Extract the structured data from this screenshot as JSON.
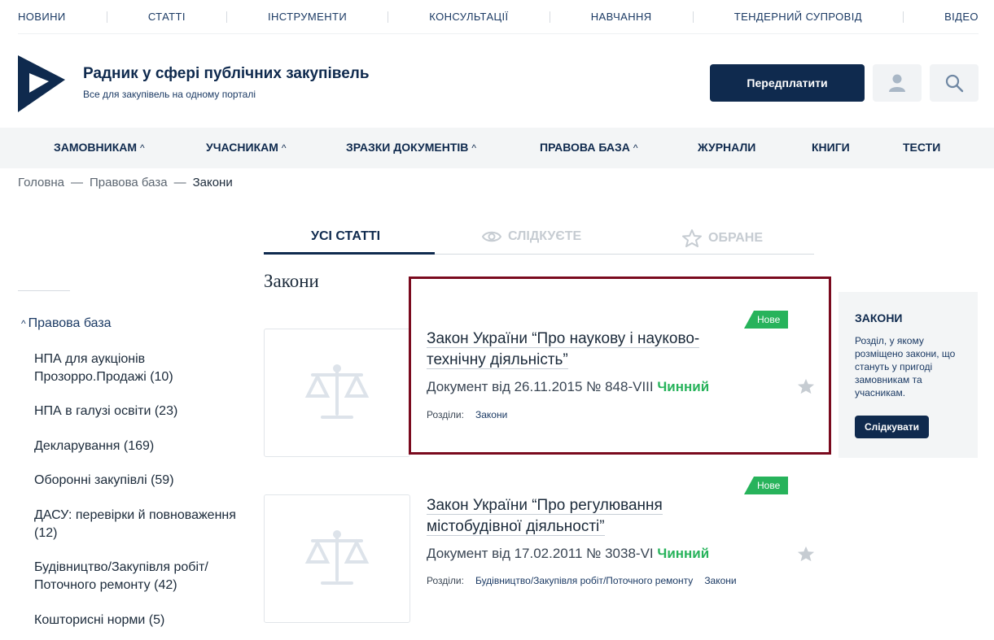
{
  "topnav": [
    "НОВИНИ",
    "СТАТТІ",
    "ІНСТРУМЕНТИ",
    "КОНСУЛЬТАЦІЇ",
    "НАВЧАННЯ",
    "ТЕНДЕРНИЙ СУПРОВІД",
    "ВІДЕО"
  ],
  "header": {
    "title": "Радник у сфері публічних закупівель",
    "subtitle": "Все для закупівель на одному порталі",
    "subscribe_label": "Передплатити",
    "user_icon": "user-icon",
    "search_icon": "search-icon"
  },
  "mainnav": {
    "customers": "ЗАМОВНИКАМ",
    "participants": "УЧАСНИКАМ",
    "samples": "ЗРАЗКИ ДОКУМЕНТІВ",
    "legal": "ПРАВОВА БАЗА",
    "journals": "ЖУРНАЛИ",
    "books": "КНИГИ",
    "tests": "ТЕСТИ"
  },
  "breadcrumb": {
    "home": "Головна",
    "legal": "Правова база",
    "current": "Закони",
    "separator": "—"
  },
  "tabs": {
    "all": "УСІ СТАТТІ",
    "following": "СЛІДКУЄТЕ",
    "favorites": "ОБРАНЕ"
  },
  "section_title": "Закони",
  "sidebar": {
    "root": "Правова база",
    "items": [
      "НПА для аукціонів Прозорро.Продажі (10)",
      "НПА в галузі освіти (23)",
      "Декларування (169)",
      "Оборонні закупівлі (59)",
      "ДАСУ: перевірки й повноваження (12)",
      "Будівництво/Закупівля робіт/Поточного ремонту (42)",
      "Кошторисні норми (5)"
    ]
  },
  "articles": [
    {
      "badge": "Нове",
      "title": "Закон України “Про наукову і науково-технічну діяльність”",
      "meta": "Документ від 26.11.2015 № 848-VIII",
      "status": "Чинний",
      "sections_label": "Розділи:",
      "sections": [
        "Закони"
      ]
    },
    {
      "badge": "Нове",
      "title": "Закон України “Про регулювання містобудівної діяльності”",
      "meta": "Документ від 17.02.2011 № 3038-VI",
      "status": "Чинний",
      "sections_label": "Розділи:",
      "sections": [
        "Будівництво/Закупівля робіт/Поточного ремонту",
        "Закони"
      ]
    }
  ],
  "info_box": {
    "title": "ЗАКОНИ",
    "text": "Розділ, у якому розміщено закони, що стануть у пригоді замовникам та учасникам.",
    "button": "Слідкувати"
  },
  "colors": {
    "brand_navy": "#0f2a4e",
    "status_green": "#27b35b",
    "highlight_border": "#7a0a1e"
  }
}
